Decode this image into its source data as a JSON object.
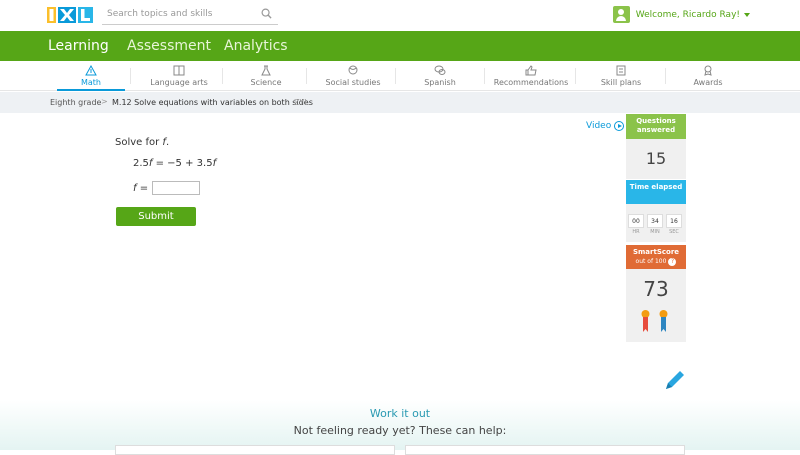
{
  "header": {
    "logo_text": "IXL",
    "search_placeholder": "Search topics and skills",
    "welcome": "Welcome, Ricardo Ray!"
  },
  "nav": {
    "tabs": [
      {
        "label": "Learning"
      },
      {
        "label": "Assessment"
      },
      {
        "label": "Analytics"
      }
    ]
  },
  "subjects": [
    {
      "label": "Math",
      "icon": "math-icon"
    },
    {
      "label": "Language arts",
      "icon": "book-icon"
    },
    {
      "label": "Science",
      "icon": "flask-icon"
    },
    {
      "label": "Social studies",
      "icon": "globe-icon"
    },
    {
      "label": "Spanish",
      "icon": "speech-icon"
    },
    {
      "label": "Recommendations",
      "icon": "thumbs-up-icon"
    },
    {
      "label": "Skill plans",
      "icon": "plan-icon"
    },
    {
      "label": "Awards",
      "icon": "awards-icon"
    }
  ],
  "breadcrumb": {
    "grade": "Eighth grade",
    "separator": ">",
    "skill": "M.12 Solve equations with variables on both sides",
    "code": "ZYL"
  },
  "problem": {
    "prompt_prefix": "Solve for ",
    "variable": "f",
    "prompt_suffix": ".",
    "equation_a": "2.5",
    "equation_b": " = −5 + 3.5",
    "answer_label_var": "f",
    "answer_label_eq": " =",
    "answer_value": "",
    "submit_label": "Submit"
  },
  "video": {
    "label": "Video"
  },
  "stats": {
    "questions_answered_label": "Questions answered",
    "questions_answered_value": "15",
    "time_elapsed_label": "Time elapsed",
    "time": [
      {
        "value": "00",
        "unit": "HR"
      },
      {
        "value": "34",
        "unit": "MIN"
      },
      {
        "value": "16",
        "unit": "SEC"
      }
    ],
    "smartscore_label": "SmartScore",
    "smartscore_sub": "out of 100",
    "smartscore_value": "73"
  },
  "footer": {
    "work_it_out": "Work it out",
    "not_ready": "Not feeling ready yet? These can help:"
  },
  "colors": {
    "green": "#56a617",
    "blue": "#0a9ad9",
    "orange": "#e06b35"
  }
}
